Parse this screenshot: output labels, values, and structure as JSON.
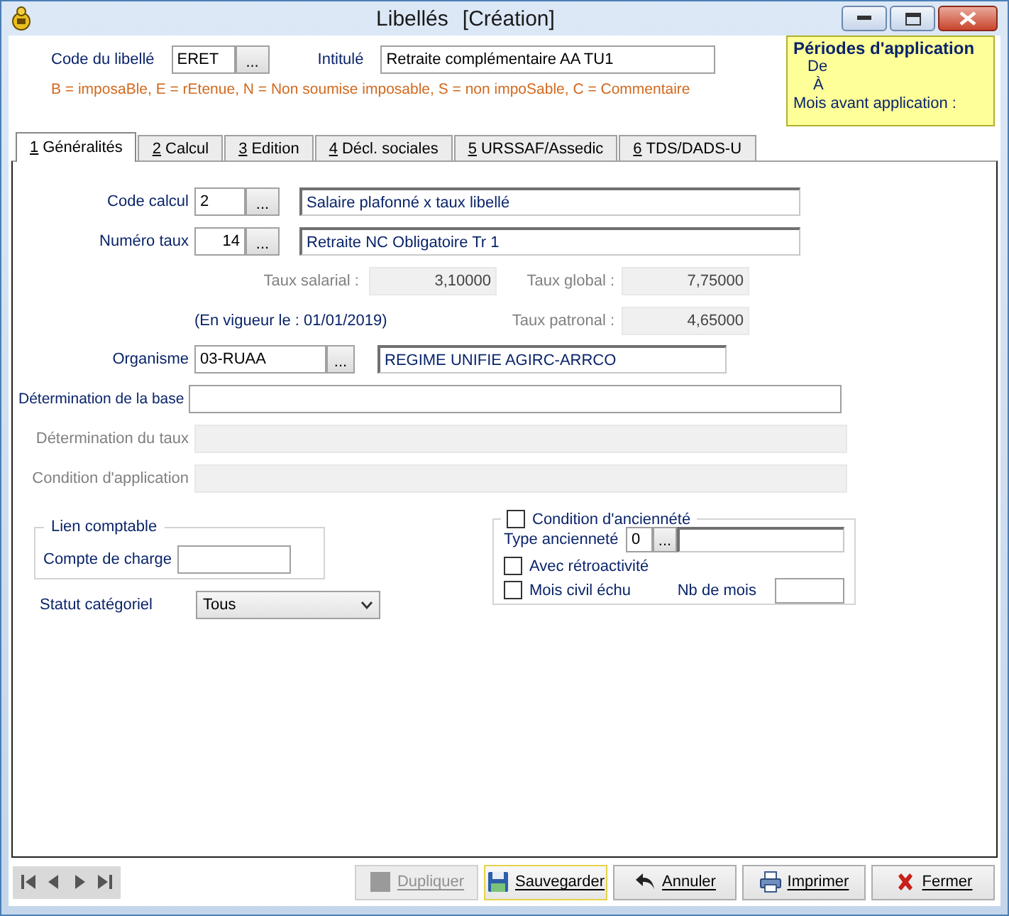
{
  "window": {
    "title": "Libellés",
    "mode": "[Création]"
  },
  "header": {
    "code_label": "Code du libellé",
    "code_value": "ERET",
    "code_button": "...",
    "intitule_label": "Intitulé",
    "intitule_value": "Retraite complémentaire AA TU1",
    "legend": "B = imposaBle, E = rEtenue, N = Non soumise imposable, S = non impoSable, C = Commentaire"
  },
  "periods": {
    "title": "Périodes d'application",
    "from_label": "De",
    "to_label": "À",
    "months_label": "Mois avant application :"
  },
  "tabs": [
    {
      "key": "1",
      "label": "Généralités",
      "selected": true
    },
    {
      "key": "2",
      "label": "Calcul",
      "selected": false
    },
    {
      "key": "3",
      "label": "Edition",
      "selected": false
    },
    {
      "key": "4",
      "label": "Décl. sociales",
      "selected": false
    },
    {
      "key": "5",
      "label": "URSSAF/Assedic",
      "selected": false
    },
    {
      "key": "6",
      "label": "TDS/DADS-U",
      "selected": false
    }
  ],
  "form": {
    "code_calcul": {
      "label": "Code calcul",
      "value": "2",
      "button": "...",
      "description": "Salaire plafonné x taux libellé"
    },
    "numero_taux": {
      "label": "Numéro taux",
      "value": "14",
      "button": "...",
      "description": "Retraite NC Obligatoire Tr 1"
    },
    "taux_salarial": {
      "label": "Taux salarial :",
      "value": "3,10000"
    },
    "taux_global": {
      "label": "Taux global :",
      "value": "7,75000"
    },
    "en_vigueur": "(En vigueur le : 01/01/2019)",
    "taux_patronal": {
      "label": "Taux patronal :",
      "value": "4,65000"
    },
    "organisme": {
      "label": "Organisme",
      "value": "03-RUAA",
      "button": "...",
      "description": "REGIME UNIFIE AGIRC-ARRCO"
    },
    "lines": [
      {
        "label": "Détermination de la base",
        "disabled": false
      },
      {
        "label": "Détermination du taux",
        "disabled": true
      },
      {
        "label": "Condition d'application",
        "disabled": true
      }
    ],
    "lien_comptable": {
      "title": "Lien comptable",
      "compte_label": "Compte de charge"
    },
    "statut": {
      "label": "Statut catégoriel",
      "value": "Tous"
    },
    "anciennete": {
      "label": "Condition d'anciennété",
      "checked": false,
      "type_label": "Type ancienneté",
      "type_value": "0",
      "type_button": "...",
      "retro_label": "Avec rétroactivité",
      "retro_checked": false,
      "mois_label": "Mois civil échu",
      "mois_checked": false,
      "nb_label": "Nb de mois"
    }
  },
  "buttons": [
    {
      "label": "Dupliquer",
      "kind": "duplicate",
      "disabled": true,
      "focused": false
    },
    {
      "label": "Sauvegarder",
      "kind": "save",
      "disabled": false,
      "focused": true
    },
    {
      "label": "Annuler",
      "kind": "cancel",
      "disabled": false,
      "focused": false
    },
    {
      "label": "Imprimer",
      "kind": "print",
      "disabled": false,
      "focused": false
    },
    {
      "label": "Fermer",
      "kind": "close",
      "disabled": false,
      "focused": false
    }
  ]
}
